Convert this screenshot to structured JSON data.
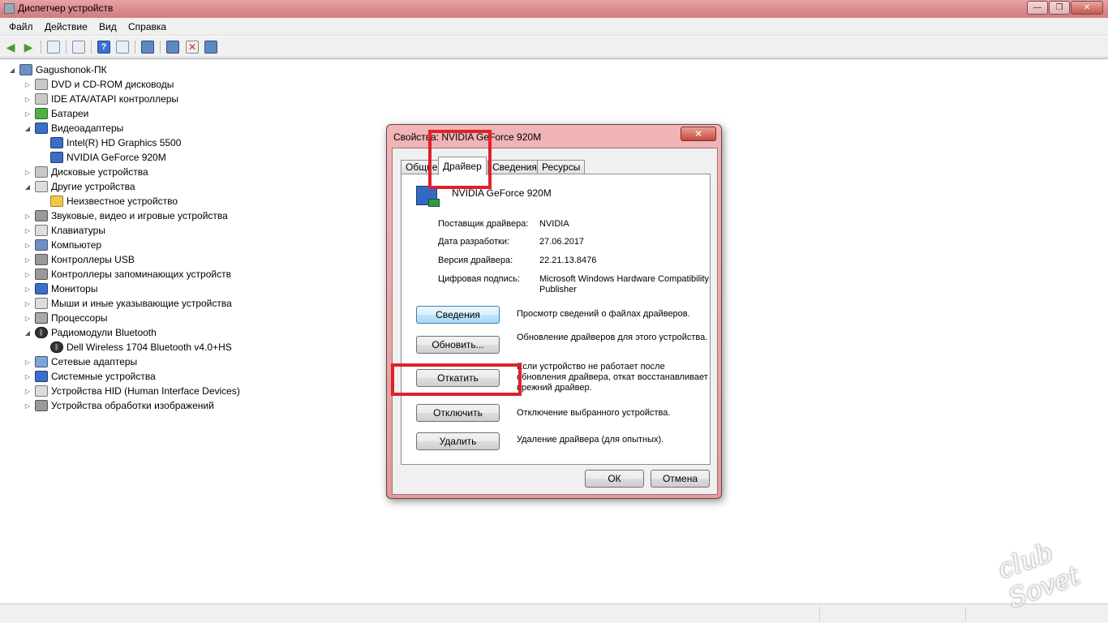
{
  "window": {
    "title": "Диспетчер устройств",
    "controls": [
      "—",
      "❐",
      "✕"
    ]
  },
  "menu": [
    "Файл",
    "Действие",
    "Вид",
    "Справка"
  ],
  "tree": {
    "root": "Gagushonok-ПК",
    "items": [
      {
        "label": "DVD и CD-ROM дисководы",
        "icon": "disk-drive-icon"
      },
      {
        "label": "IDE ATA/ATAPI контроллеры",
        "icon": "ide-controller-icon"
      },
      {
        "label": "Батареи",
        "icon": "battery-icon"
      },
      {
        "label": "Видеоадаптеры",
        "icon": "display-adapter-icon",
        "expanded": true
      },
      {
        "label": "Intel(R) HD Graphics 5500",
        "icon": "display-adapter-icon",
        "child": true
      },
      {
        "label": "NVIDIA GeForce 920M",
        "icon": "display-adapter-icon",
        "child": true
      },
      {
        "label": "Дисковые устройства",
        "icon": "disk-icon"
      },
      {
        "label": "Другие устройства",
        "icon": "unknown-device-icon",
        "expanded": true
      },
      {
        "label": "Неизвестное устройство",
        "icon": "warning-device-icon",
        "child": true
      },
      {
        "label": "Звуковые, видео и игровые устройства",
        "icon": "sound-icon"
      },
      {
        "label": "Клавиатуры",
        "icon": "keyboard-icon"
      },
      {
        "label": "Компьютер",
        "icon": "computer-icon"
      },
      {
        "label": "Контроллеры USB",
        "icon": "usb-icon"
      },
      {
        "label": "Контроллеры запоминающих устройств",
        "icon": "storage-controller-icon"
      },
      {
        "label": "Мониторы",
        "icon": "monitor-icon"
      },
      {
        "label": "Мыши и иные указывающие устройства",
        "icon": "mouse-icon"
      },
      {
        "label": "Процессоры",
        "icon": "processor-icon"
      },
      {
        "label": "Радиомодули Bluetooth",
        "icon": "bluetooth-icon",
        "expanded": true
      },
      {
        "label": "Dell Wireless 1704 Bluetooth v4.0+HS",
        "icon": "bluetooth-icon",
        "child": true
      },
      {
        "label": "Сетевые адаптеры",
        "icon": "network-icon"
      },
      {
        "label": "Системные устройства",
        "icon": "system-device-icon"
      },
      {
        "label": "Устройства HID (Human Interface Devices)",
        "icon": "hid-icon"
      },
      {
        "label": "Устройства обработки изображений",
        "icon": "imaging-icon"
      }
    ]
  },
  "dialog": {
    "title": "Свойства: NVIDIA GeForce 920M",
    "tabs": [
      "Общие",
      "Драйвер",
      "Сведения",
      "Ресурсы"
    ],
    "active_tab": "Драйвер",
    "device_name": "NVIDIA GeForce 920M",
    "props": [
      {
        "label": "Поставщик драйвера:",
        "value": "NVIDIA"
      },
      {
        "label": "Дата разработки:",
        "value": "27.06.2017"
      },
      {
        "label": "Версия драйвера:",
        "value": "22.21.13.8476"
      },
      {
        "label": "Цифровая подпись:",
        "value": "Microsoft Windows Hardware Compatibility Publisher"
      }
    ],
    "actions": [
      {
        "label": "Сведения",
        "desc": "Просмотр сведений о файлах драйверов."
      },
      {
        "label": "Обновить...",
        "desc": "Обновление драйверов для этого устройства."
      },
      {
        "label": "Откатить",
        "desc": "Если устройство не работает после обновления драйвера, откат восстанавливает прежний драйвер."
      },
      {
        "label": "Отключить",
        "desc": "Отключение выбранного устройства."
      },
      {
        "label": "Удалить",
        "desc": "Удаление драйвера (для опытных)."
      }
    ],
    "ok": "ОК",
    "cancel": "Отмена"
  },
  "watermark": "club Sovet",
  "colors": {
    "highlight": "#e0202a",
    "titlebar": "#d98a8e"
  }
}
